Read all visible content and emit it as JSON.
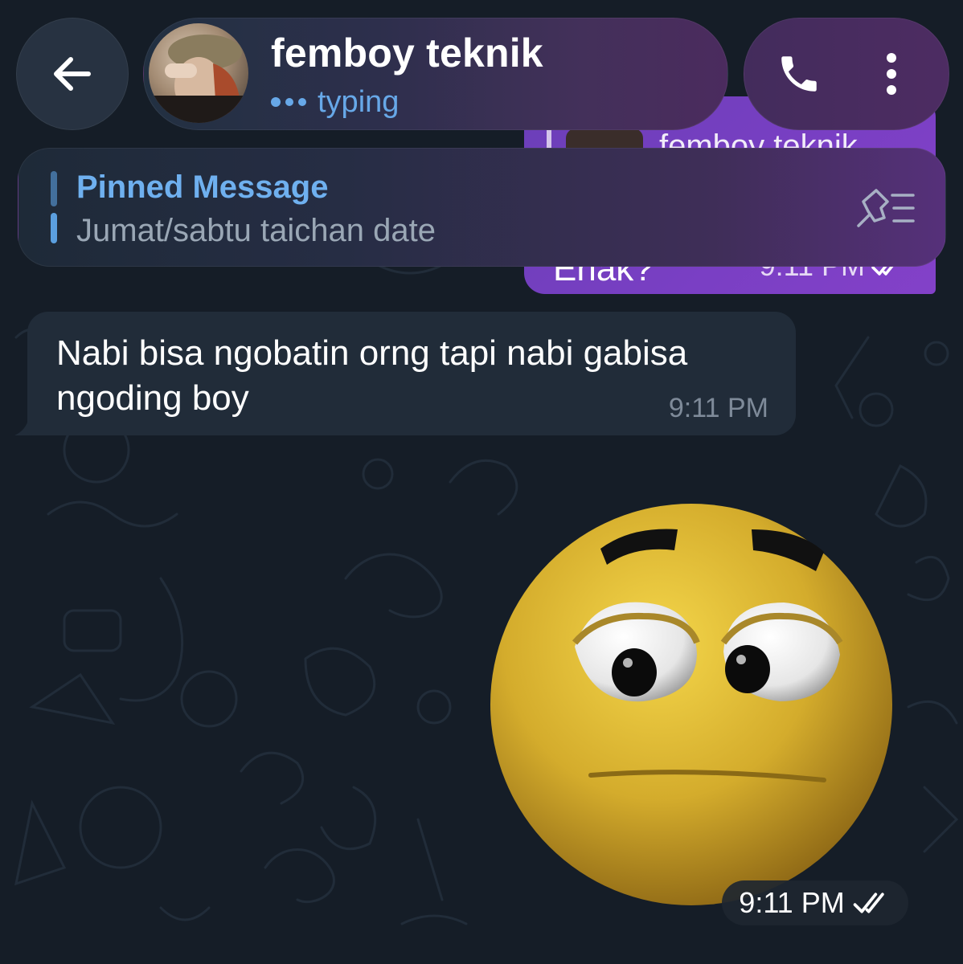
{
  "header": {
    "back_icon": "arrow-left-icon",
    "chat_name": "femboy teknik",
    "status": "typing",
    "call_icon": "phone-icon",
    "menu_icon": "more-vertical-icon"
  },
  "pinned": {
    "title": "Pinned Message",
    "text": "Jumat/sabtu taichan date",
    "icon": "pin-list-icon"
  },
  "messages": [
    {
      "direction": "outgoing",
      "reply_name": "femboy teknik",
      "text": "Enak?",
      "time": "9:11 PM",
      "read": true
    },
    {
      "direction": "incoming",
      "text": "Nabi bisa ngobatin orng tapi nabi gabisa ngoding boy",
      "time": "9:11 PM"
    },
    {
      "direction": "outgoing",
      "type": "sticker",
      "sticker": "worried-smiley-sticker",
      "time": "9:11 PM",
      "read": true
    }
  ],
  "colors": {
    "background": "#151d27",
    "accent": "#67a8e8",
    "outgoing_bubble": "#7a3fc4",
    "incoming_bubble": "#212c39"
  }
}
